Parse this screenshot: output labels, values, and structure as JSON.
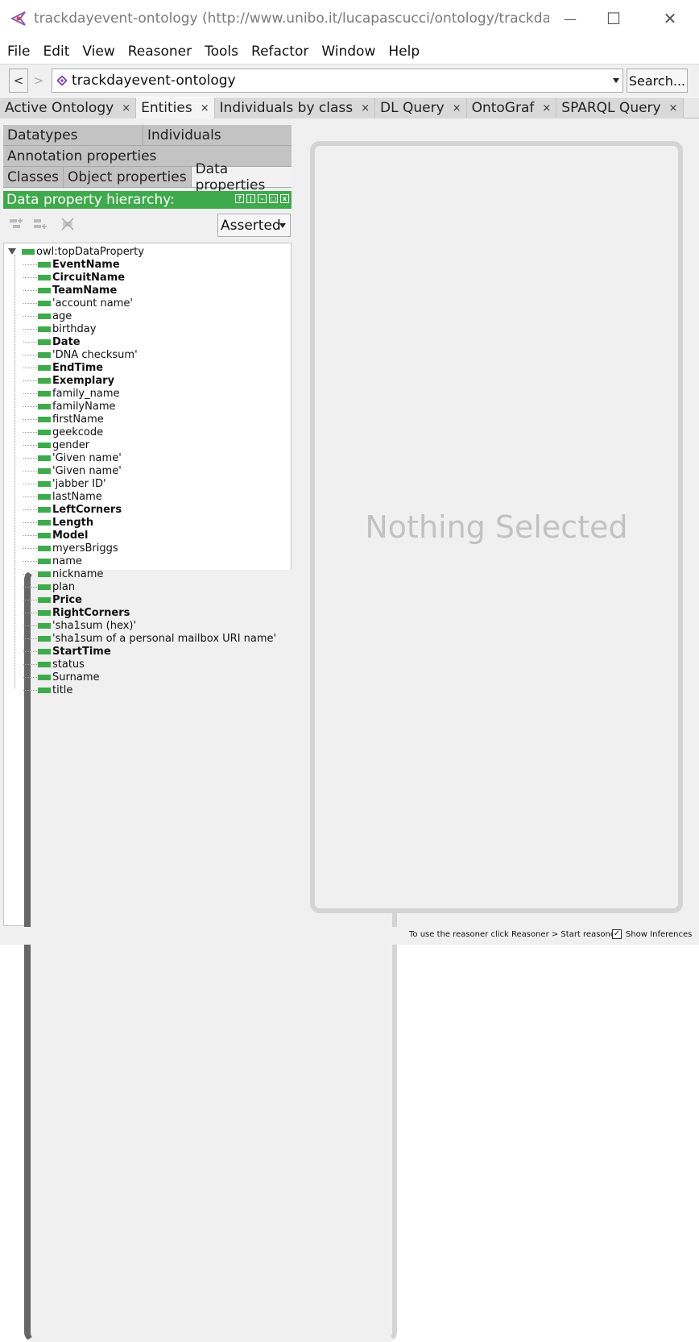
{
  "window": {
    "title": "trackdayevent-ontology (http://www.unibo.it/lucapascucci/ontology/trackda...",
    "min_icon": "—",
    "max_icon": "☐",
    "close_icon": "✕"
  },
  "menu": [
    "File",
    "Edit",
    "View",
    "Reasoner",
    "Tools",
    "Refactor",
    "Window",
    "Help"
  ],
  "address": {
    "back_label": "<",
    "forward_label": ">",
    "ontology": "trackdayevent-ontology",
    "search_label": "Search..."
  },
  "tabs": [
    {
      "label": "Active Ontology",
      "active": false
    },
    {
      "label": "Entities",
      "active": true
    },
    {
      "label": "Individuals by class",
      "active": false
    },
    {
      "label": "DL Query",
      "active": false
    },
    {
      "label": "OntoGraf",
      "active": false
    },
    {
      "label": "SPARQL Query",
      "active": false
    }
  ],
  "tab_close": "×",
  "entity_tabs": {
    "row1": [
      "Datatypes",
      "Individuals"
    ],
    "row2": [
      "Annotation properties"
    ],
    "row3": [
      "Classes",
      "Object properties",
      "Data properties"
    ]
  },
  "view": {
    "title": "Data property hierarchy:",
    "asserted_label": "Asserted",
    "header_buttons": [
      "?",
      "|",
      "–",
      "□",
      "x"
    ]
  },
  "tree": {
    "root": "owl:topDataProperty",
    "items": [
      {
        "label": "EventName",
        "bold": true
      },
      {
        "label": "CircuitName",
        "bold": true
      },
      {
        "label": "TeamName",
        "bold": true
      },
      {
        "label": "'account name'",
        "bold": false
      },
      {
        "label": "age",
        "bold": false
      },
      {
        "label": "birthday",
        "bold": false
      },
      {
        "label": "Date",
        "bold": true
      },
      {
        "label": "'DNA checksum'",
        "bold": false
      },
      {
        "label": "EndTime",
        "bold": true
      },
      {
        "label": "Exemplary",
        "bold": true
      },
      {
        "label": "family_name",
        "bold": false
      },
      {
        "label": "familyName",
        "bold": false
      },
      {
        "label": "firstName",
        "bold": false
      },
      {
        "label": "geekcode",
        "bold": false
      },
      {
        "label": "gender",
        "bold": false
      },
      {
        "label": "'Given name'",
        "bold": false
      },
      {
        "label": "'Given name'",
        "bold": false
      },
      {
        "label": "'jabber ID'",
        "bold": false
      },
      {
        "label": "lastName",
        "bold": false
      },
      {
        "label": "LeftCorners",
        "bold": true
      },
      {
        "label": "Length",
        "bold": true
      },
      {
        "label": "Model",
        "bold": true
      },
      {
        "label": "myersBriggs",
        "bold": false
      },
      {
        "label": "name",
        "bold": false
      },
      {
        "label": "nickname",
        "bold": false,
        "expandable": true
      },
      {
        "label": "plan",
        "bold": false
      },
      {
        "label": "Price",
        "bold": true
      },
      {
        "label": "RightCorners",
        "bold": true
      },
      {
        "label": "'sha1sum (hex)'",
        "bold": false
      },
      {
        "label": "'sha1sum of a personal mailbox URI name'",
        "bold": false
      },
      {
        "label": "StartTime",
        "bold": true
      },
      {
        "label": "status",
        "bold": false
      },
      {
        "label": "Surname",
        "bold": false
      },
      {
        "label": "title",
        "bold": false
      }
    ]
  },
  "right_panel": {
    "placeholder": "Nothing Selected"
  },
  "status": {
    "message": "To use the reasoner click Reasoner > Start reasoner",
    "show_inferences_label": "Show Inferences",
    "show_inferences_checked": true,
    "check_mark": "✓"
  },
  "colors": {
    "accent_green": "#3eaa4c",
    "ontology_icon": "#7a3fa6"
  }
}
